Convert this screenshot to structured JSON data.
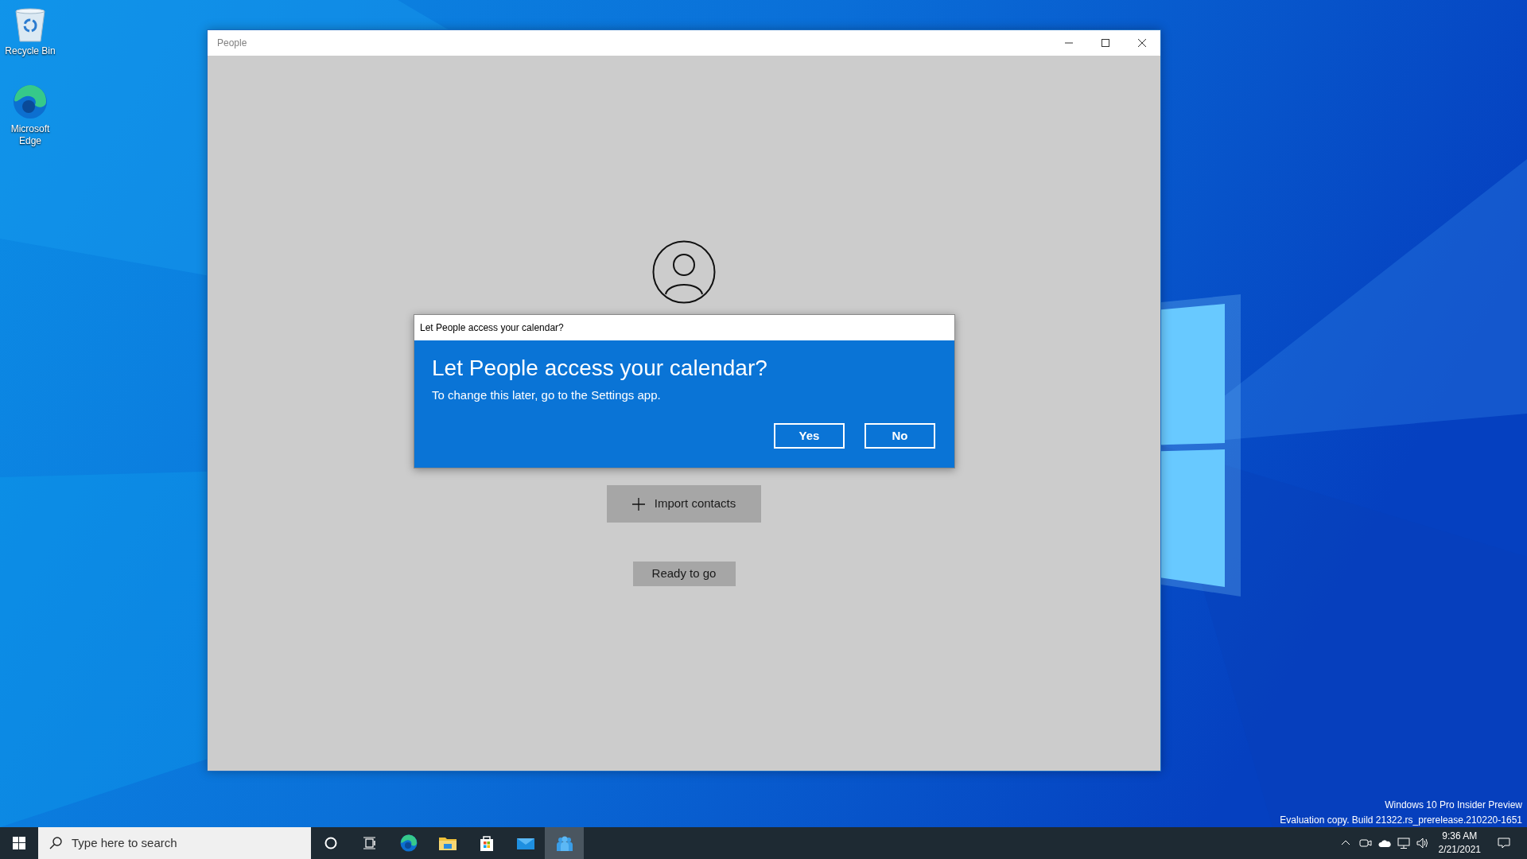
{
  "desktop": {
    "icons": [
      {
        "kind": "recycle-bin",
        "label": "Recycle Bin"
      },
      {
        "kind": "edge",
        "label": "Microsoft Edge"
      }
    ],
    "build_info": [
      "Windows 10 Pro Insider Preview",
      "Evaluation copy. Build 21322.rs_prerelease.210220-1651"
    ]
  },
  "window": {
    "title": "People"
  },
  "content": {
    "import_button": "Import contacts",
    "ready_button": "Ready to go"
  },
  "dialog": {
    "title": "Let People access your calendar?",
    "heading": "Let People access your calendar?",
    "message": "To change this later, go to the Settings app.",
    "buttons": [
      {
        "label": "Yes"
      },
      {
        "label": "No"
      }
    ]
  },
  "taskbar": {
    "search": {
      "placeholder": "Type here to search"
    },
    "apps": [
      {
        "kind": "edge",
        "selected": false
      },
      {
        "kind": "explorer",
        "selected": false
      },
      {
        "kind": "store",
        "selected": false
      },
      {
        "kind": "mail",
        "selected": false
      },
      {
        "kind": "people",
        "selected": true
      }
    ],
    "clock": {
      "time": "9:36 AM",
      "date": "2/21/2021"
    }
  }
}
